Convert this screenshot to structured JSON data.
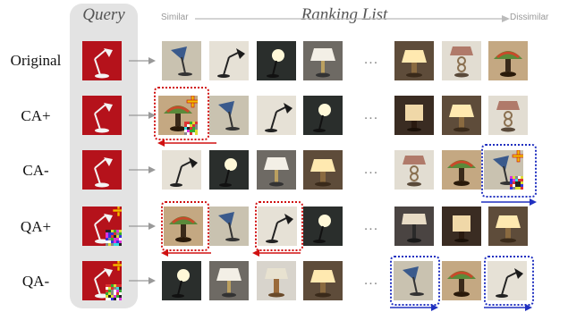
{
  "header": {
    "query_title": "Query",
    "ranking_title": "Ranking List",
    "similar_label": "Similar",
    "dissimilar_label": "Dissimilar"
  },
  "rows": [
    {
      "label": "Original",
      "perturbed_query": false
    },
    {
      "label": "CA+",
      "perturbed_query": false
    },
    {
      "label": "CA-",
      "perturbed_query": false
    },
    {
      "label": "QA+",
      "perturbed_query": true
    },
    {
      "label": "QA-",
      "perturbed_query": true
    }
  ],
  "ellipsis": "...",
  "colors": {
    "panel": "#e3e3e3",
    "red_highlight": "#d01010",
    "blue_highlight": "#2030c0",
    "plus_marker": "#f0c000"
  },
  "thumb_types": {
    "A": "blue-desk-lamp",
    "B": "swing-arm-lamp",
    "C": "bulb-lamp-dark",
    "D": "white-shade-lamp",
    "E": "warm-lamp",
    "F": "stacked-lamp",
    "G": "tiffany-lamp",
    "H": "square-shade-lamp",
    "I": "wood-lamp",
    "J": "dark-lamp"
  }
}
